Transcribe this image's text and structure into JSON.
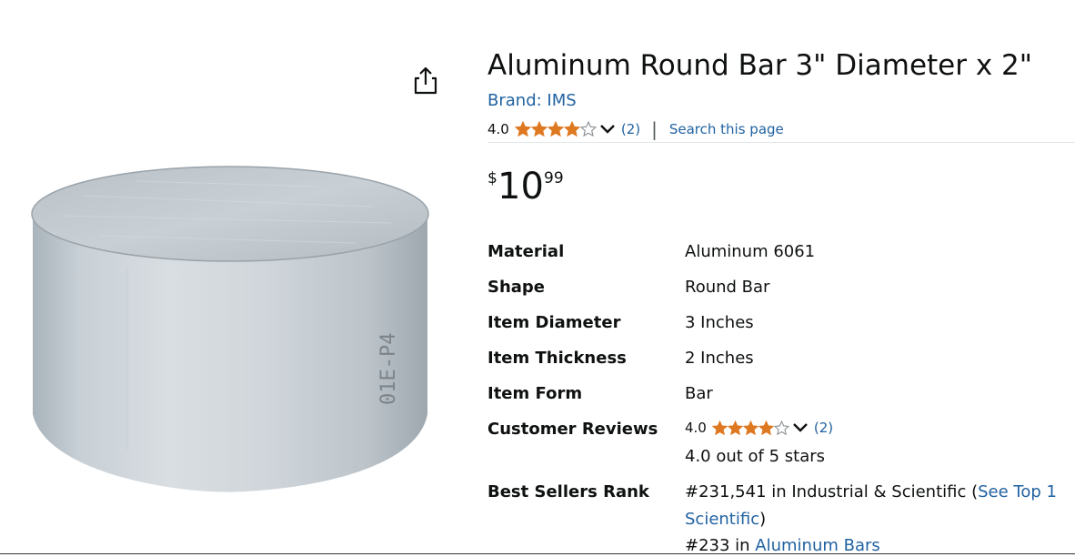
{
  "product": {
    "title": "Aluminum Round Bar 3\" Diameter x 2\"",
    "brand": "Brand: IMS",
    "rating_value": "4.0",
    "rating_count": "(2)",
    "rating_fraction": 0.8,
    "search_link": "Search this page",
    "price": {
      "symbol": "$",
      "whole": "10",
      "fraction": "99"
    }
  },
  "specs": [
    {
      "label": "Material",
      "value": "Aluminum 6061"
    },
    {
      "label": "Shape",
      "value": "Round Bar"
    },
    {
      "label": "Item Diameter",
      "value": "3 Inches"
    },
    {
      "label": "Item Thickness",
      "value": "2 Inches"
    },
    {
      "label": "Item Form",
      "value": "Bar"
    },
    {
      "label": "Customer Reviews",
      "rating_value": "4.0",
      "rating_count": "(2)",
      "stars_text": "4.0 out of 5 stars"
    },
    {
      "label": "Best Sellers Rank",
      "rank1_text": "#231,541 in Industrial & Scientific (",
      "rank1_link": "See Top 1",
      "rank1_link_cont": "Scientific",
      "rank1_close": ")",
      "rank2_text": "#233 in ",
      "rank2_link": "Aluminum Bars"
    }
  ],
  "colors": {
    "link": "#2162a1",
    "star": "#de7921",
    "text": "#0f1111"
  },
  "icons": {
    "share": "share-icon",
    "chevron": "chevron-down-icon",
    "star": "star-icon"
  },
  "stamp_text": "01E-P4"
}
